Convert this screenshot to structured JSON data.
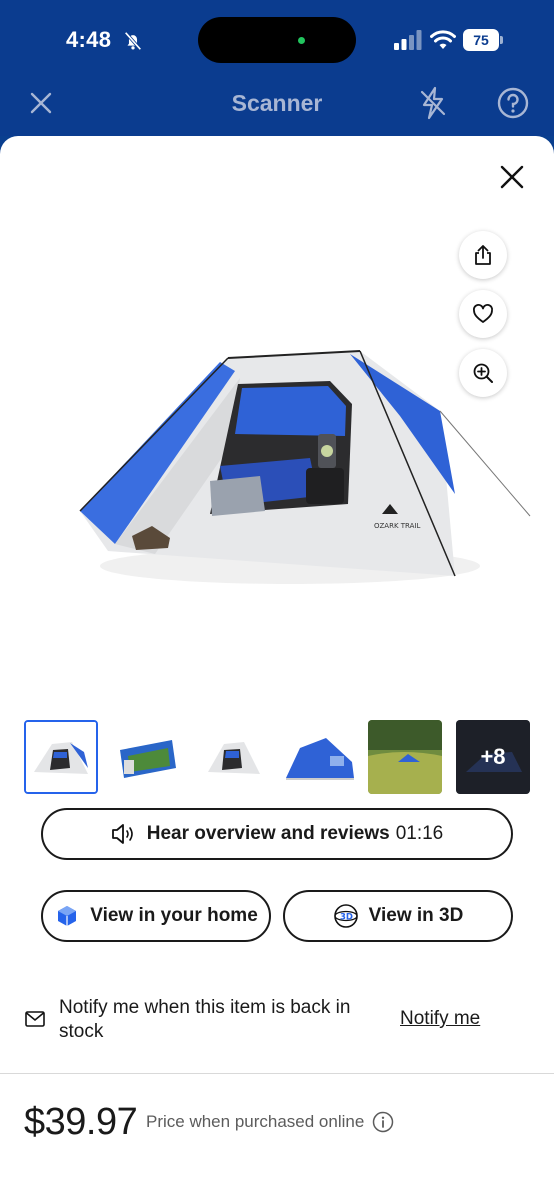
{
  "status_bar": {
    "time": "4:48",
    "battery": "75"
  },
  "scanner": {
    "title": "Scanner"
  },
  "product": {
    "thumbnails_more": "+8",
    "hear_label": "Hear overview and reviews",
    "hear_duration": "01:16",
    "view_home_label": "View in your home",
    "view_3d_label": "View in 3D",
    "notify_text": "Notify me when this item is back in stock",
    "notify_link": "Notify me",
    "price": "$39.97",
    "price_note": "Price when purchased online",
    "tent_brand": "OZARK TRAIL"
  },
  "colors": {
    "brand_blue": "#0b3c8f",
    "accent_blue": "#2563eb",
    "tent_blue": "#2f62d6"
  }
}
